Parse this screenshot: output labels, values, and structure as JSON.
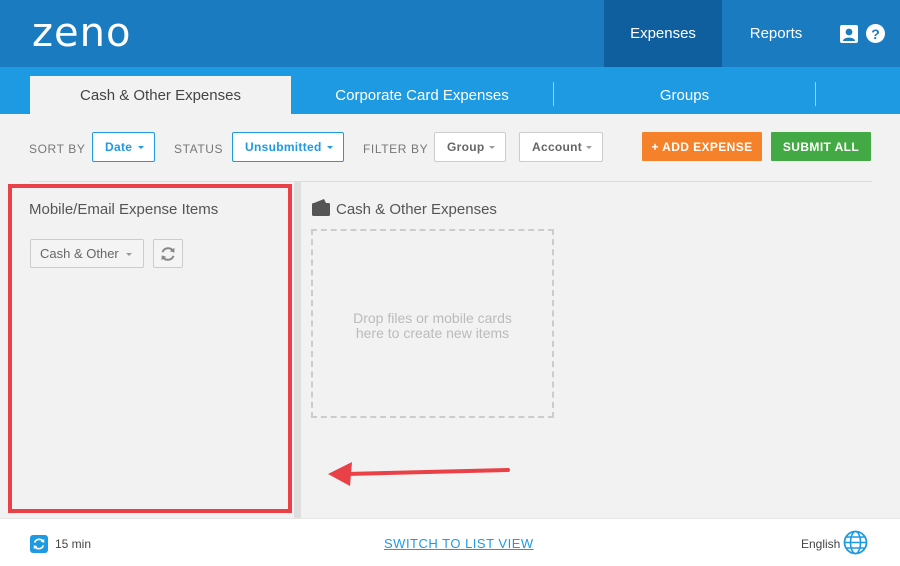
{
  "header": {
    "logo": "zeno",
    "nav": {
      "expenses": "Expenses",
      "reports": "Reports"
    },
    "help": "?",
    "colors": {
      "bar": "#1a7bc0",
      "active": "#0f5f9e"
    }
  },
  "tabs": [
    {
      "label": "Cash & Other Expenses",
      "active": true
    },
    {
      "label": "Corporate Card Expenses",
      "active": false
    },
    {
      "label": "Groups",
      "active": false
    }
  ],
  "filters": {
    "sort_by_label": "SORT BY",
    "sort_by_value": "Date",
    "status_label": "STATUS",
    "status_value": "Unsubmitted",
    "filter_by_label": "FILTER BY",
    "group_value": "Group",
    "account_value": "Account"
  },
  "actions": {
    "add_expense": "+ ADD EXPENSE",
    "submit_all": "SUBMIT ALL",
    "colors": {
      "add": "#f5822a",
      "submit": "#43a944"
    }
  },
  "left_panel": {
    "title": "Mobile/Email Expense Items",
    "type_select": "Cash & Other",
    "refresh_icon": "refresh-icon"
  },
  "right_panel": {
    "title": "Cash & Other Expenses",
    "icon": "wallet-icon",
    "dropzone_line1": "Drop files or mobile cards",
    "dropzone_line2": "here to create new items"
  },
  "footer": {
    "refresh_interval": "15 min",
    "switch_view": "SWITCH TO LIST VIEW",
    "language": "English"
  },
  "annotation": {
    "highlight_color": "#e94147"
  }
}
